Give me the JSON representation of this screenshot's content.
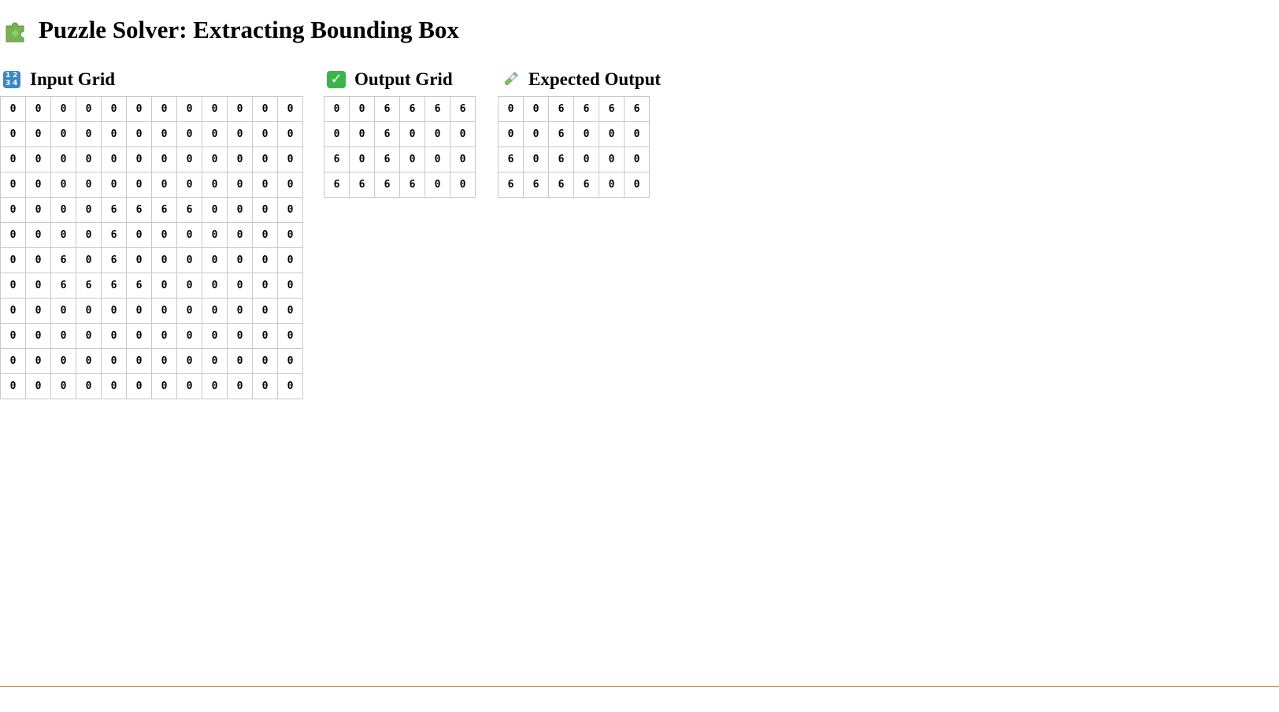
{
  "page": {
    "title": "Puzzle Solver: Extracting Bounding Box"
  },
  "icons": {
    "title_icon": "puzzle-piece-icon",
    "input_icon": "input-numbers-icon",
    "output_icon": "check-mark-button-icon",
    "expected_icon": "test-tube-icon"
  },
  "input_grid": {
    "title": "Input Grid",
    "rows": [
      [
        0,
        0,
        0,
        0,
        0,
        0,
        0,
        0,
        0,
        0,
        0,
        0
      ],
      [
        0,
        0,
        0,
        0,
        0,
        0,
        0,
        0,
        0,
        0,
        0,
        0
      ],
      [
        0,
        0,
        0,
        0,
        0,
        0,
        0,
        0,
        0,
        0,
        0,
        0
      ],
      [
        0,
        0,
        0,
        0,
        0,
        0,
        0,
        0,
        0,
        0,
        0,
        0
      ],
      [
        0,
        0,
        0,
        0,
        6,
        6,
        6,
        6,
        0,
        0,
        0,
        0
      ],
      [
        0,
        0,
        0,
        0,
        6,
        0,
        0,
        0,
        0,
        0,
        0,
        0
      ],
      [
        0,
        0,
        6,
        0,
        6,
        0,
        0,
        0,
        0,
        0,
        0,
        0
      ],
      [
        0,
        0,
        6,
        6,
        6,
        6,
        0,
        0,
        0,
        0,
        0,
        0
      ],
      [
        0,
        0,
        0,
        0,
        0,
        0,
        0,
        0,
        0,
        0,
        0,
        0
      ],
      [
        0,
        0,
        0,
        0,
        0,
        0,
        0,
        0,
        0,
        0,
        0,
        0
      ],
      [
        0,
        0,
        0,
        0,
        0,
        0,
        0,
        0,
        0,
        0,
        0,
        0
      ],
      [
        0,
        0,
        0,
        0,
        0,
        0,
        0,
        0,
        0,
        0,
        0,
        0
      ]
    ]
  },
  "output_grid": {
    "title": "Output Grid",
    "rows": [
      [
        0,
        0,
        6,
        6,
        6,
        6
      ],
      [
        0,
        0,
        6,
        0,
        0,
        0
      ],
      [
        6,
        0,
        6,
        0,
        0,
        0
      ],
      [
        6,
        6,
        6,
        6,
        0,
        0
      ]
    ]
  },
  "expected_grid": {
    "title": "Expected Output",
    "rows": [
      [
        0,
        0,
        6,
        6,
        6,
        6
      ],
      [
        0,
        0,
        6,
        0,
        0,
        0
      ],
      [
        6,
        0,
        6,
        0,
        0,
        0
      ],
      [
        6,
        6,
        6,
        6,
        0,
        0
      ]
    ]
  },
  "colors": {
    "cell_border": "#c8c8c8",
    "bottom_rule": "#d38a4a"
  }
}
